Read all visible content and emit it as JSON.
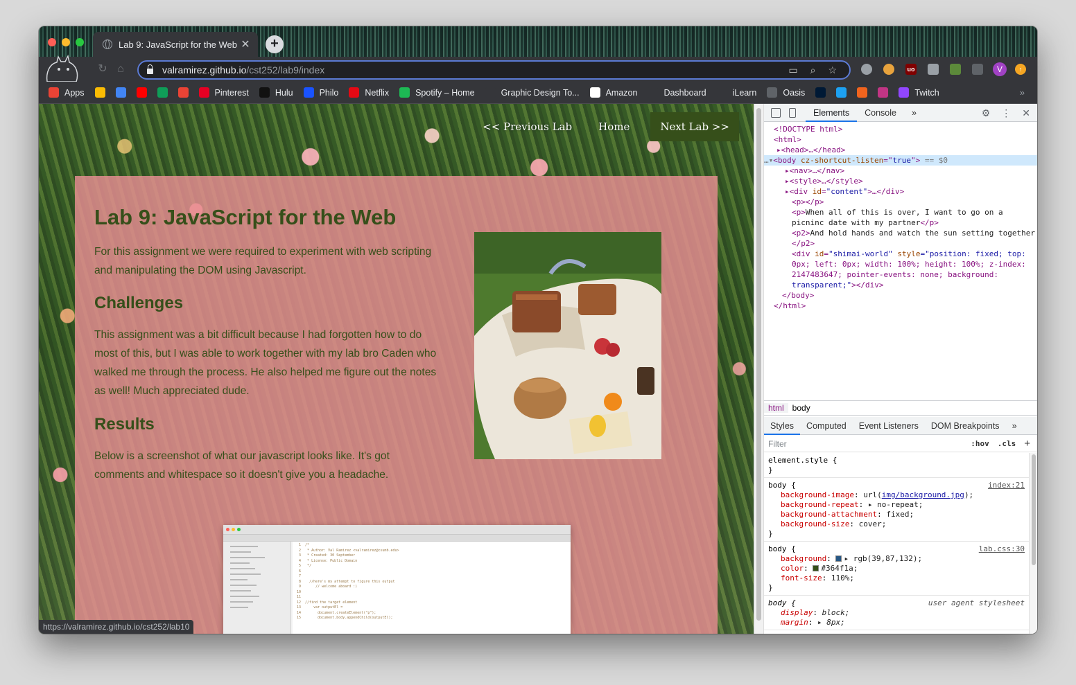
{
  "browser": {
    "tab_title": "Lab 9: JavaScript for the Web",
    "tab_close": "✕",
    "new_tab": "+",
    "url_host": "valramirez.github.io",
    "url_path": "/cst252/lab9/index",
    "avatar_letter": "V",
    "status_url": "https://valramirez.github.io/cst252/lab10"
  },
  "bookmarks": [
    {
      "label": "Apps",
      "icon": "apps-grid-icon",
      "color": "#ea4335"
    },
    {
      "label": "",
      "icon": "google-drive-icon",
      "color": "#fbbc04"
    },
    {
      "label": "",
      "icon": "google-docs-icon",
      "color": "#4285f4"
    },
    {
      "label": "",
      "icon": "youtube-icon",
      "color": "#ff0000"
    },
    {
      "label": "",
      "icon": "google-sheets-icon",
      "color": "#0f9d58"
    },
    {
      "label": "",
      "icon": "gmail-icon",
      "color": "#ea4335"
    },
    {
      "label": "Pinterest",
      "icon": "pinterest-icon",
      "color": "#e60023"
    },
    {
      "label": "Hulu",
      "icon": "hulu-icon",
      "color": "#111111"
    },
    {
      "label": "Philo",
      "icon": "philo-icon",
      "color": "#1a53ff"
    },
    {
      "label": "Netflix",
      "icon": "netflix-icon",
      "color": "#e50914"
    },
    {
      "label": "Spotify – Home",
      "icon": "spotify-icon",
      "color": "#1db954"
    },
    {
      "label": "Graphic Design To...",
      "icon": "folder-icon",
      "color": "#35363a"
    },
    {
      "label": "Amazon",
      "icon": "amazon-icon",
      "color": "#ffffff"
    },
    {
      "label": "Dashboard",
      "icon": "canvas-icon",
      "color": "#35363a"
    },
    {
      "label": "iLearn",
      "icon": "ilearn-icon",
      "color": "#35363a"
    },
    {
      "label": "Oasis",
      "icon": "oasis-globe-icon",
      "color": "#5f6368"
    },
    {
      "label": "",
      "icon": "tumblr-icon",
      "color": "#001935"
    },
    {
      "label": "",
      "icon": "twitter-icon",
      "color": "#1da1f2"
    },
    {
      "label": "",
      "icon": "etsy-icon",
      "color": "#f1641e"
    },
    {
      "label": "",
      "icon": "instagram-icon",
      "color": "#c13584"
    },
    {
      "label": "Twitch",
      "icon": "twitch-icon",
      "color": "#9146ff"
    }
  ],
  "page": {
    "nav": {
      "prev": "<< Previous Lab",
      "home": "Home",
      "next": "Next Lab >>"
    },
    "title": "Lab 9: JavaScript for the Web",
    "intro": "For this assignment we were required to experiment with web scripting and manipulating the DOM using Javascript.",
    "challenges_heading": "Challenges",
    "challenges_text": "This assignment was a bit difficult because I had forgotten how to do most of this, but I was able to work together with my lab bro Caden who walked me through the process. He also helped me figure out the notes as well! Much appreciated dude.",
    "results_heading": "Results",
    "results_text": "Below is a screenshot of what our javascript looks like. It's got comments and whitespace so it doesn't give you a headache.",
    "code_lines": [
      "/*",
      " * Author: Val Ramirez <valramirez@csumb.edu>",
      " * Created: 30 September",
      " * License: Public Domain",
      " */",
      "",
      "",
      "  //here's my attempt to figure this output",
      "     // welcome aboard :)",
      "",
      "",
      "//find the target element",
      "    var outputEl =",
      "      document.createElement(\"p\");",
      "      document.body.appendChild(outputEl);"
    ],
    "colors": {
      "text_green": "#364f1a",
      "box_pink": "#e98f94"
    }
  },
  "devtools": {
    "tabs": [
      "Elements",
      "Console",
      "»"
    ],
    "active_tab": "Elements",
    "breadcrumbs": [
      "html",
      "body"
    ],
    "style_tabs": [
      "Styles",
      "Computed",
      "Event Listeners",
      "DOM Breakpoints",
      "»"
    ],
    "filter_placeholder": "Filter",
    "hov": ":hov",
    "cls": ".cls",
    "plus": "+",
    "element_style": "element.style {",
    "close_brace": "}",
    "rule1": {
      "selector": "body {",
      "source": "index:21",
      "props": [
        {
          "name": "background-image",
          "value_pre": "url(",
          "link": "img/background.jpg",
          "value_post": ");"
        },
        {
          "name": "background-repeat",
          "value_pre": "▸ no-repeat;",
          "link": "",
          "value_post": ""
        },
        {
          "name": "background-attachment",
          "value_pre": "fixed;",
          "link": "",
          "value_post": ""
        },
        {
          "name": "background-size",
          "value_pre": "cover;",
          "link": "",
          "value_post": ""
        }
      ]
    },
    "rule2": {
      "selector": "body {",
      "source": "lab.css:30",
      "background_name": "background",
      "background_value": "▸ rgb(39,87,132);",
      "background_swatch": "#275784",
      "color_name": "color",
      "color_value": "#364f1a;",
      "color_swatch": "#364f1a",
      "font_name": "font-size",
      "font_value": "110%;"
    },
    "rule3": {
      "selector": "body {",
      "source": "user agent stylesheet",
      "display_name": "display",
      "display_value": "block;",
      "margin_name": "margin",
      "margin_value": "▸ 8px;"
    },
    "dom": {
      "doctype": "<!DOCTYPE html>",
      "html_open": "<html>",
      "head": "▸<head>…</head>",
      "body_prefix": "…▾",
      "body_tag": "<body ",
      "body_attr": "cz-shortcut-listen",
      "body_eq": "=\"",
      "body_val": "true",
      "body_close": "\">",
      "body_marker": " == $0",
      "nav": "▸<nav>…</nav>",
      "style": "▸<style>…</style>",
      "content_open": "▸<div ",
      "content_attr": "id",
      "content_val": "\"content\"",
      "content_close": ">…</div>",
      "p_empty": "<p></p>",
      "p_open": "<p>",
      "p_text_1": "When all of this is over, I want to go on a",
      "p_text_2": "picninc date with my partner",
      "p_close": "</p>",
      "p2_open": "<p2>",
      "p2_text": "And hold hands and watch the sun setting together",
      "p2_close": "</p2>",
      "shimai_open": "<div ",
      "shimai_id_attr": "id",
      "shimai_id_val": "\"shimai-world\"",
      "shimai_style_attr": " style",
      "shimai_style_val_1": "=\"position: fixed; top:",
      "shimai_style_val_2": "0px; left: 0px; width: 100%; height: 100%; z-index:",
      "shimai_style_val_3": "2147483647; pointer-events: none; background:",
      "shimai_style_val_4": "transparent;\"",
      "shimai_close": "></div>",
      "body_end": "</body>",
      "html_end": "</html>"
    }
  }
}
